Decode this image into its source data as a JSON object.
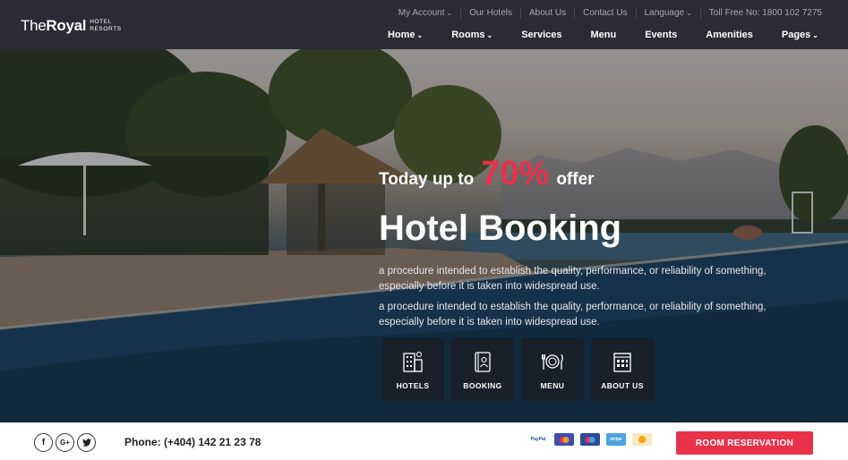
{
  "brand": {
    "name_light": "The",
    "name_bold": "Royal",
    "sub_line1": "HOTEL",
    "sub_line2": "RESORTS"
  },
  "topbar": {
    "my_account": "My Account",
    "our_hotels": "Our Hotels",
    "about_us": "About Us",
    "contact_us": "Contact Us",
    "language": "Language",
    "toll_free": "Toll Free No: 1800 102 7275"
  },
  "nav": {
    "home": "Home",
    "rooms": "Rooms",
    "services": "Services",
    "menu": "Menu",
    "events": "Events",
    "amenities": "Amenities",
    "pages": "Pages"
  },
  "hero": {
    "offer_prefix": "Today up to",
    "offer_percent": "70%",
    "offer_suffix": "offer",
    "title": "Hotel Booking",
    "desc1": "a procedure intended to establish the quality, performance, or reliability of something, especially before it is taken into widespread use.",
    "desc2": "a procedure intended to establish the quality, performance, or reliability of something, especially before it is taken into widespread use."
  },
  "features": [
    {
      "label": "HOTELS",
      "icon": "hotel-building-icon"
    },
    {
      "label": "BOOKING",
      "icon": "booking-book-icon"
    },
    {
      "label": "MENU",
      "icon": "plate-cutlery-icon"
    },
    {
      "label": "ABOUT US",
      "icon": "building-info-icon"
    }
  ],
  "bottom": {
    "social": {
      "facebook": "f",
      "google_plus": "G+",
      "twitter": "twitter-icon"
    },
    "phone": "Phone: (+404) 142 21 23 78",
    "payments": {
      "paypal": "PayPal",
      "stripe": "stripe"
    },
    "reserve_button": "ROOM RESERVATION"
  },
  "colors": {
    "header_bg": "#2b2b34",
    "accent": "#e8324a",
    "feature_tile": "#1c1e26"
  }
}
